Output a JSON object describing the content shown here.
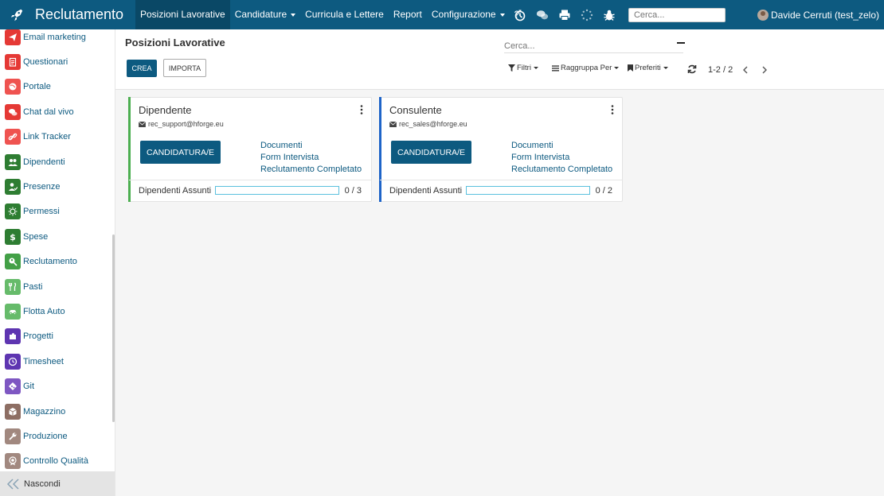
{
  "app": {
    "title": "Reclutamento"
  },
  "nav": {
    "items": [
      {
        "label": "Posizioni Lavorative",
        "active": true,
        "dropdown": false
      },
      {
        "label": "Candidature",
        "active": false,
        "dropdown": true
      },
      {
        "label": "Curricula e Lettere",
        "active": false,
        "dropdown": false
      },
      {
        "label": "Report",
        "active": false,
        "dropdown": false
      },
      {
        "label": "Configurazione",
        "active": false,
        "dropdown": true
      },
      {
        "label": "?",
        "active": false,
        "dropdown": false
      }
    ],
    "search_placeholder": "Cerca...",
    "user_name": "Davide Cerruti (test_zelo)",
    "icons": [
      "timer-icon",
      "chat-icon",
      "print-icon",
      "loading-icon",
      "debug-bug-icon"
    ]
  },
  "sidebar": {
    "items": [
      {
        "label": "Email marketing",
        "icon": "paper-plane-icon",
        "color": "#e53935"
      },
      {
        "label": "Questionari",
        "icon": "clipboard-icon",
        "color": "#e53935"
      },
      {
        "label": "Portale",
        "icon": "globe-icon",
        "color": "#ef5350"
      },
      {
        "label": "Chat dal vivo",
        "icon": "chat-bubbles-icon",
        "color": "#e53935"
      },
      {
        "label": "Link Tracker",
        "icon": "link-icon",
        "color": "#ef5350"
      },
      {
        "label": "Dipendenti",
        "icon": "users-icon",
        "color": "#2e7d32"
      },
      {
        "label": "Presenze",
        "icon": "user-check-icon",
        "color": "#2e7d32"
      },
      {
        "label": "Permessi",
        "icon": "sun-icon",
        "color": "#2e7d32"
      },
      {
        "label": "Spese",
        "icon": "dollar-icon",
        "color": "#2e7d32"
      },
      {
        "label": "Reclutamento",
        "icon": "magnifier-user-icon",
        "color": "#43a047"
      },
      {
        "label": "Pasti",
        "icon": "cutlery-icon",
        "color": "#66bb6a"
      },
      {
        "label": "Flotta Auto",
        "icon": "car-icon",
        "color": "#66bb6a"
      },
      {
        "label": "Progetti",
        "icon": "puzzle-icon",
        "color": "#5e35b1"
      },
      {
        "label": "Timesheet",
        "icon": "clock-icon",
        "color": "#5e35b1"
      },
      {
        "label": "Git",
        "icon": "git-icon",
        "color": "#7e57c2"
      },
      {
        "label": "Magazzino",
        "icon": "box-icon",
        "color": "#8d6e63"
      },
      {
        "label": "Produzione",
        "icon": "wrench-icon",
        "color": "#a1887f"
      },
      {
        "label": "Controllo Qualità",
        "icon": "badge-icon",
        "color": "#a1887f"
      }
    ],
    "hide_label": "Nascondi"
  },
  "control_panel": {
    "title": "Posizioni Lavorative",
    "create_label": "CREA",
    "import_label": "IMPORTA",
    "search_placeholder": "Cerca...",
    "filters_label": "Filtri",
    "groupby_label": "Raggruppa Per",
    "favorites_label": "Preferiti",
    "pager_value": "1-2 / 2"
  },
  "cards": [
    {
      "name": "Dipendente",
      "email": "rec_support@hforge.eu",
      "button_label": "CANDIDATURA/E",
      "links": [
        "Documenti",
        "Form Intervista",
        "Reclutamento Completato"
      ],
      "progress_label": "Dipendenti Assunti",
      "hired": 0,
      "expected": 3,
      "count_text": "0 / 3",
      "stripe_color": "#4caf50"
    },
    {
      "name": "Consulente",
      "email": "rec_sales@hforge.eu",
      "button_label": "CANDIDATURA/E",
      "links": [
        "Documenti",
        "Form Intervista",
        "Reclutamento Completato"
      ],
      "progress_label": "Dipendenti Assunti",
      "hired": 0,
      "expected": 2,
      "count_text": "0 / 2",
      "stripe_color": "#1e64c8"
    }
  ],
  "colors": {
    "primary": "#0d5a80",
    "nav_active": "#0a4866",
    "progress": "#5bc0de"
  }
}
